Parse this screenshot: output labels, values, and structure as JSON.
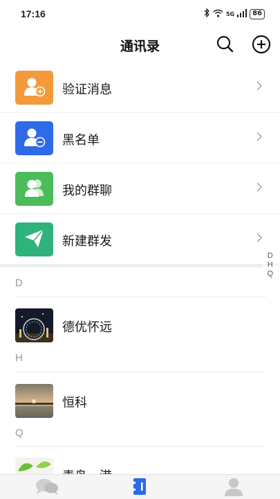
{
  "status": {
    "time": "17:16",
    "battery": "86",
    "network": "5G"
  },
  "header": {
    "title": "通讯录"
  },
  "menu": [
    {
      "label": "验证消息",
      "icon": "add-user-icon",
      "color": "#F39B3A"
    },
    {
      "label": "黑名单",
      "icon": "block-user-icon",
      "color": "#2F6BE8"
    },
    {
      "label": "我的群聊",
      "icon": "group-icon",
      "color": "#4CBB5A"
    },
    {
      "label": "新建群发",
      "icon": "send-icon",
      "color": "#2FB27C"
    }
  ],
  "index_letters": [
    "D",
    "H",
    "Q"
  ],
  "sections": [
    {
      "letter": "D",
      "contacts": [
        {
          "name": "德优怀远"
        }
      ]
    },
    {
      "letter": "H",
      "contacts": [
        {
          "name": "恒科"
        }
      ]
    },
    {
      "letter": "Q",
      "contacts": [
        {
          "name": "青岛一港"
        }
      ]
    }
  ],
  "tabs": [
    {
      "name": "messages",
      "icon": "chat-icon",
      "active": false
    },
    {
      "name": "contacts",
      "icon": "contacts-book-icon",
      "active": true
    },
    {
      "name": "me",
      "icon": "person-icon",
      "active": false
    }
  ]
}
